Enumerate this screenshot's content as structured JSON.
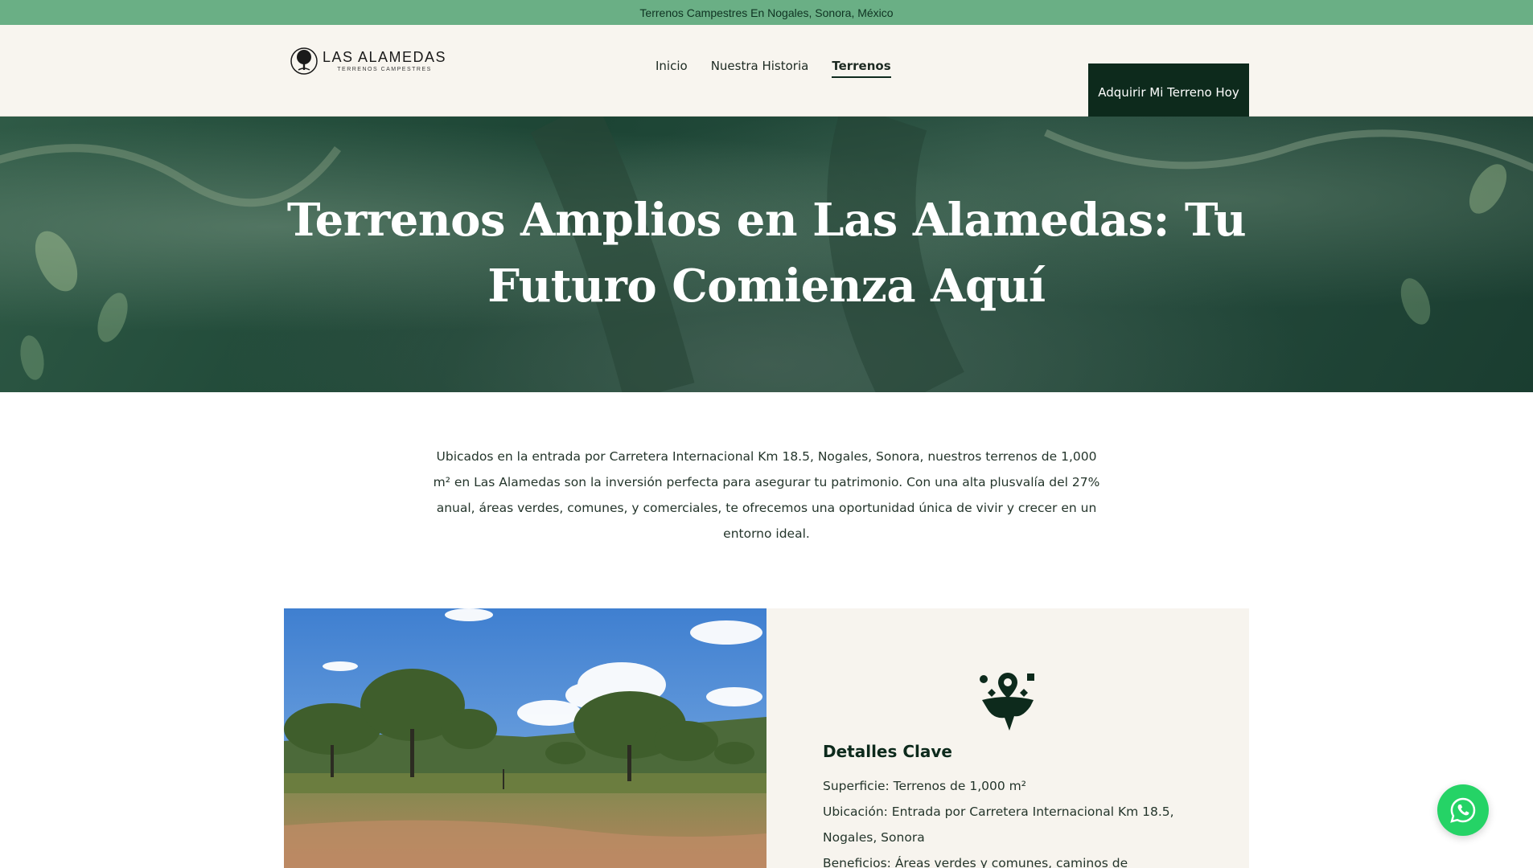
{
  "topbar": {
    "text": "Terrenos Campestres En Nogales, Sonora, México"
  },
  "logo": {
    "title": "LAS ALAMEDAS",
    "subtitle": "TERRENOS CAMPESTRES"
  },
  "nav": {
    "items": [
      {
        "label": "Inicio",
        "active": false
      },
      {
        "label": "Nuestra Historia",
        "active": false
      },
      {
        "label": "Terrenos",
        "active": true
      }
    ]
  },
  "cta": {
    "label": "Adquirir Mi Terreno Hoy"
  },
  "hero": {
    "title": "Terrenos Amplios en Las Alamedas: Tu Futuro Comienza Aquí"
  },
  "intro": {
    "text": "Ubicados en la entrada por Carretera Internacional Km 18.5, Nogales, Sonora, nuestros terrenos de 1,000 m² en Las Alamedas son la inversión perfecta para asegurar tu patrimonio. Con una alta plusvalía del 27% anual, áreas verdes, comunes, y comerciales, te ofrecemos una oportunidad única de vivir y crecer en un entorno ideal."
  },
  "details": {
    "icon": "map-location-icon",
    "title": "Detalles Clave",
    "items": [
      "Superficie: Terrenos de 1,000 m²",
      "Ubicación: Entrada por Carretera Internacional Km 18.5, Nogales, Sonora",
      "Beneficios: Áreas verdes y comunes, caminos de"
    ]
  },
  "whatsapp": {
    "icon": "whatsapp-icon"
  },
  "colors": {
    "topbar": "#6aaf85",
    "header_bg": "#f8f5ef",
    "dark_green": "#0d2a1c",
    "details_bg": "#f7f4ee",
    "whatsapp": "#25d366"
  }
}
